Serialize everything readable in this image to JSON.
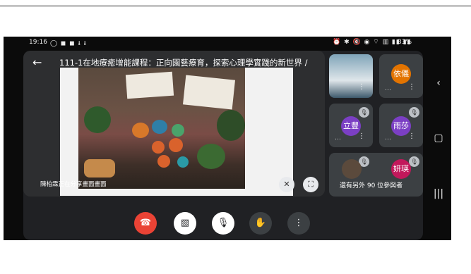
{
  "status_bar": {
    "time": "19:16",
    "left_icons": "◯ ◼ ◼ ⭳ ⭳",
    "right_icons": "⏰ ✱ 🔇 ◉ ⌔ ▥ ▮▮ ▮▮",
    "battery": "33%"
  },
  "meeting": {
    "title": "111-1在地療癒增能課程：正向園藝療育，探索心理學實踐的新世界 /",
    "presenter_label": "陳柏霖正在分享畫面畫面"
  },
  "participants": [
    {
      "name": "依儀",
      "avatar_text": "依儀",
      "color": "#e37400"
    },
    {
      "name": "立豐",
      "avatar_text": "立豐",
      "color": "#7b3fc4"
    },
    {
      "name": "雨莎",
      "avatar_text": "雨莎",
      "color": "#7b3fc4"
    },
    {
      "name": "妍瑛",
      "avatar_text": "妍瑛",
      "color": "#c2185b"
    }
  ],
  "others_label": "還有另外 90 位參與者",
  "controls": {
    "end_call": "end-call",
    "camera": "camera-off",
    "mic": "mic-off",
    "hand": "raise-hand",
    "more": "more-options"
  },
  "colors": {
    "end_call": "#ea4335",
    "control_bg": "#3c4043",
    "active_bg": "#ffffff"
  }
}
